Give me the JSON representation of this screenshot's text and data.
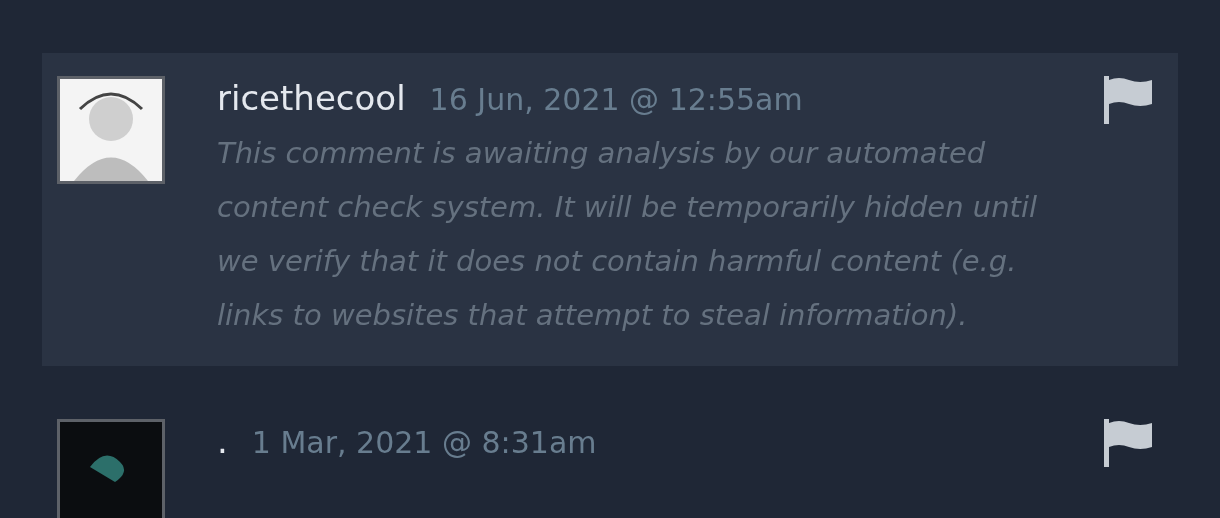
{
  "comments": [
    {
      "author": "ricethecool",
      "timestamp": "16 Jun, 2021 @ 12:55am",
      "highlighted": true,
      "text": "This comment is awaiting analysis by our automated content check system. It will be temporarily hidden until we verify that it does not contain harmful content (e.g. links to websites that attempt to steal information)."
    },
    {
      "author": ".",
      "timestamp": "1 Mar, 2021 @ 8:31am",
      "highlighted": false
    }
  ]
}
